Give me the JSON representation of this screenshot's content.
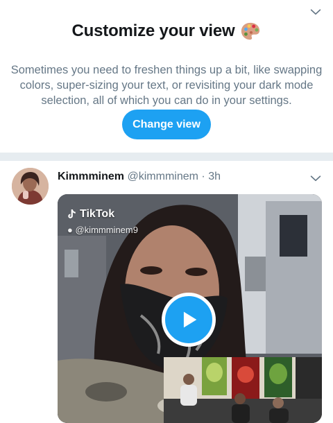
{
  "prompt": {
    "title": "Customize your view",
    "title_icon": "artist-palette-icon",
    "body": "Sometimes you need to freshen things up a bit, like swapping colors, super-sizing your text, or revisiting your dark mode selection, all of which you can do in your settings.",
    "button_label": "Change view",
    "accent_color": "#1da1f2"
  },
  "tweet": {
    "display_name": "Kimmminem",
    "handle": "@kimmminem",
    "separator": "·",
    "time": "3h",
    "media": {
      "watermark_brand": "TikTok",
      "watermark_handle": "@kimmminem9",
      "play_icon": "play-icon"
    }
  },
  "colors": {
    "text_primary": "#14171a",
    "text_secondary": "#657786",
    "divider": "#e6ecf0"
  }
}
